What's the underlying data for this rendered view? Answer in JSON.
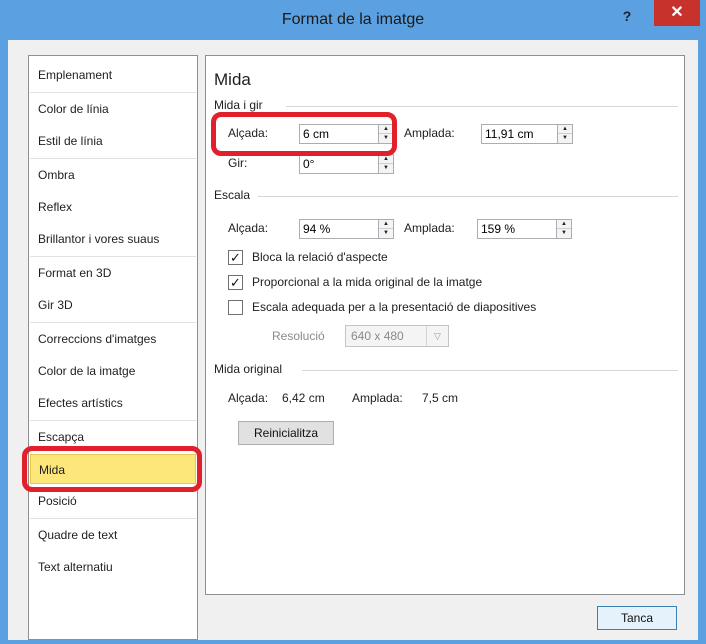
{
  "window": {
    "title": "Format de la imatge",
    "help_label": "?",
    "close_label": "✕"
  },
  "sidebar": {
    "items": [
      {
        "label": "Emplenament"
      },
      {
        "label": "Color de línia"
      },
      {
        "label": "Estil de línia"
      },
      {
        "label": "Ombra"
      },
      {
        "label": "Reflex"
      },
      {
        "label": "Brillantor i vores suaus"
      },
      {
        "label": "Format en 3D"
      },
      {
        "label": "Gir 3D"
      },
      {
        "label": "Correccions d'imatges"
      },
      {
        "label": "Color de la imatge"
      },
      {
        "label": "Efectes artístics"
      },
      {
        "label": "Escapça"
      },
      {
        "label": "Mida"
      },
      {
        "label": "Posició"
      },
      {
        "label": "Quadre de text"
      },
      {
        "label": "Text alternatiu"
      }
    ],
    "selected": "Mida"
  },
  "panel": {
    "heading": "Mida",
    "size_rotate": {
      "group_label": "Mida i gir",
      "height_label": "Alçada:",
      "height_value": "6 cm",
      "width_label": "Amplada:",
      "width_value": "11,91 cm",
      "rotation_label": "Gir:",
      "rotation_value": "0°"
    },
    "scale": {
      "group_label": "Escala",
      "height_label": "Alçada:",
      "height_value": "94 %",
      "width_label": "Amplada:",
      "width_value": "159 %",
      "lock_aspect_label": "Bloca la relació d'aspecte",
      "lock_aspect_checked": true,
      "relative_original_label": "Proporcional a la mida original de la imatge",
      "relative_original_checked": true,
      "best_scale_label": "Escala adequada per a la presentació de diapositives",
      "best_scale_checked": false,
      "resolution_label": "Resolució",
      "resolution_value": "640 x 480"
    },
    "original": {
      "group_label": "Mida original",
      "height_label": "Alçada:",
      "height_value": "6,42 cm",
      "width_label": "Amplada:",
      "width_value": "7,5 cm",
      "reset_label": "Reinicialitza"
    }
  },
  "footer": {
    "close_label": "Tanca"
  },
  "colors": {
    "titlebar": "#5ba0e0",
    "close_button": "#c7322d",
    "selected_item": "#fde67a",
    "highlight": "#e0202a"
  }
}
